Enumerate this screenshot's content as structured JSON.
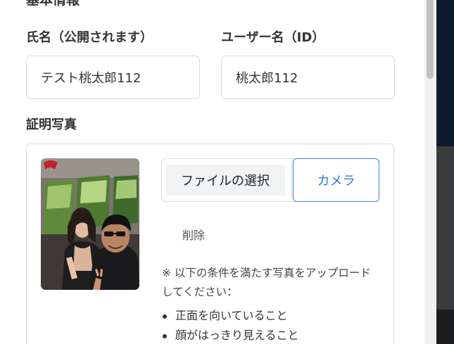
{
  "basic_info": {
    "heading": "基本情報"
  },
  "full_name": {
    "label": "氏名（公開されます）",
    "value": "テスト桃太郎112"
  },
  "username": {
    "label": "ユーザー名（ID）",
    "value": "桃太郎112"
  },
  "id_photo": {
    "label": "証明写真",
    "file_select_label": "ファイルの選択",
    "camera_label": "カメラ",
    "delete_label": "削除",
    "note": "※ 以下の条件を満たす写真をアップロードしてください：",
    "conditions": [
      "正面を向いていること",
      "顔がはっきり見えること"
    ]
  },
  "colors": {
    "accent": "#2d7ae2",
    "border": "#dcdcdc",
    "text": "#333333"
  }
}
